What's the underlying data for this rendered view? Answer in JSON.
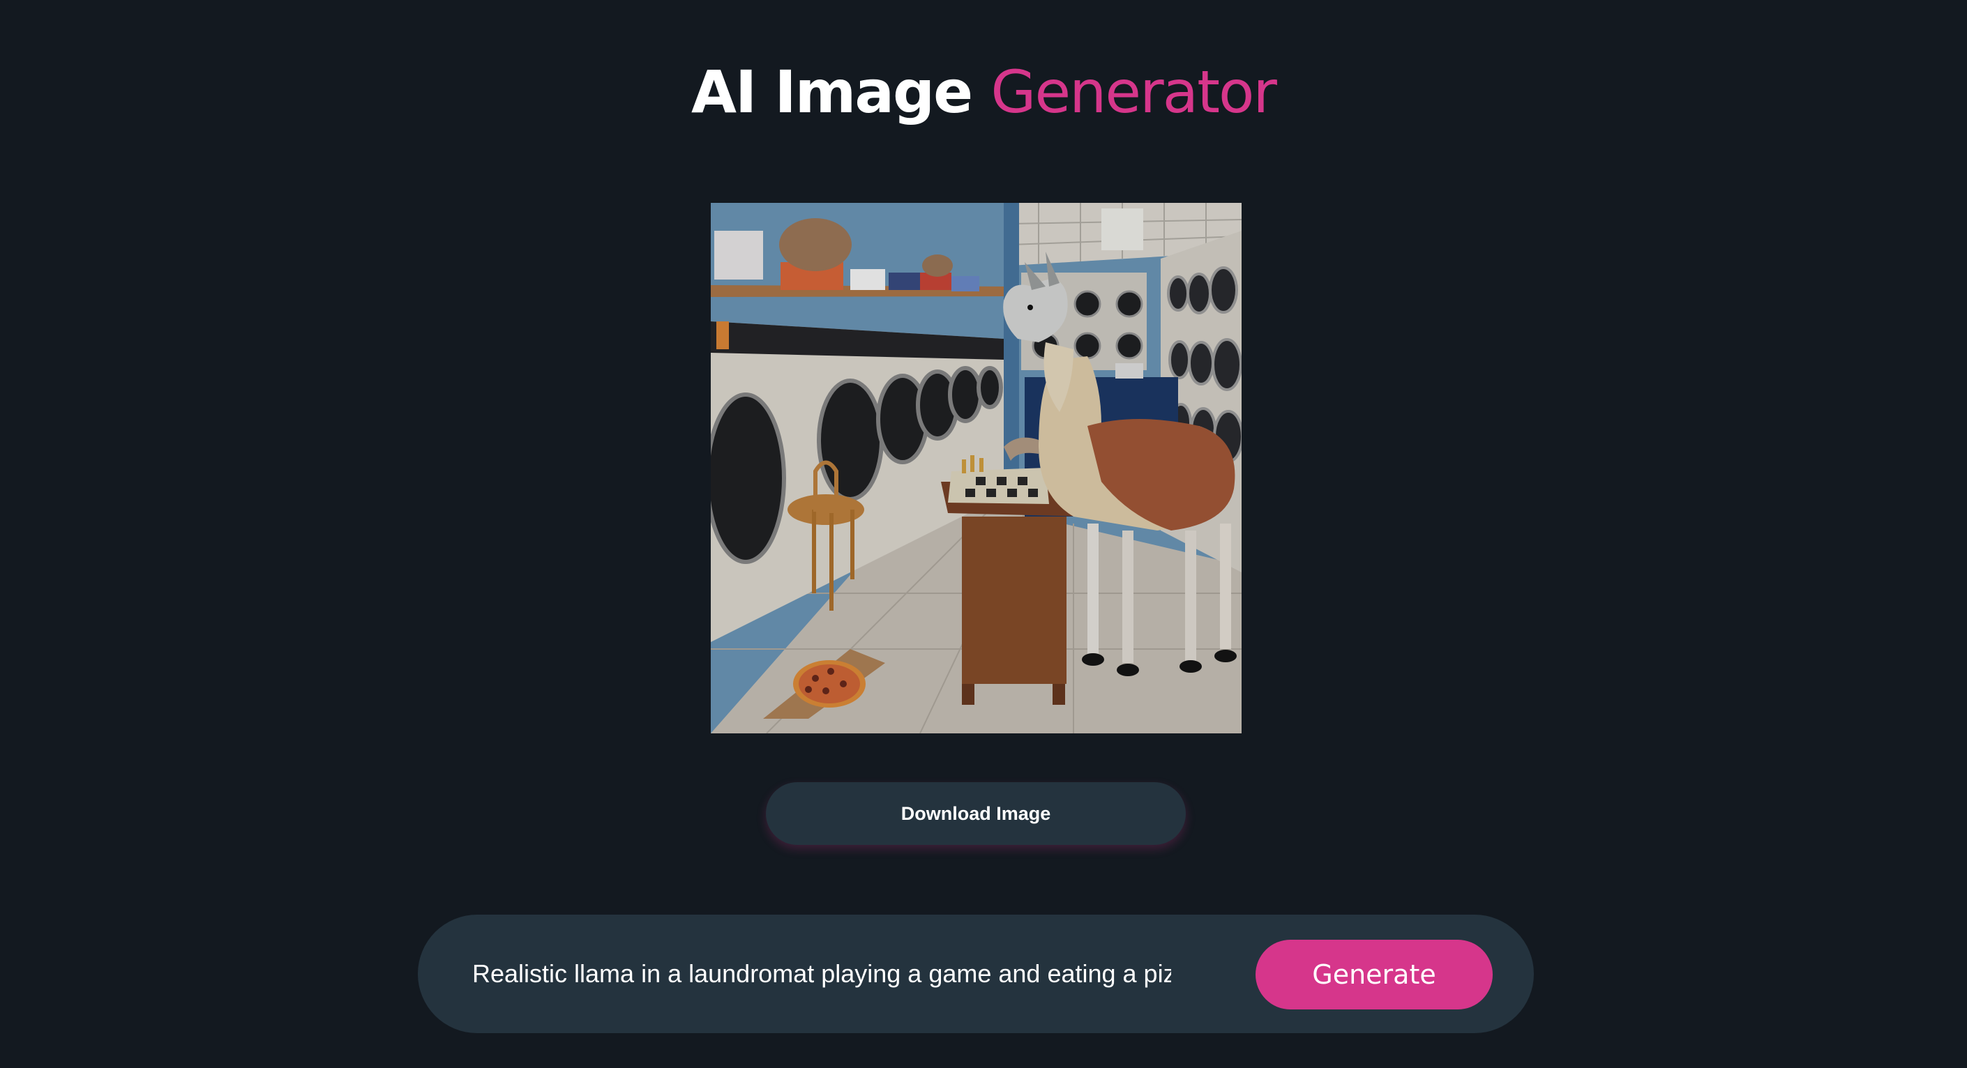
{
  "header": {
    "title_part1": "AI Image",
    "title_part2": "Generator",
    "accent_color": "#d6368b"
  },
  "result": {
    "download_label": "Download Image"
  },
  "prompt": {
    "value": "Realistic llama in a laundromat playing a game and eating a pizza",
    "generate_label": "Generate"
  }
}
